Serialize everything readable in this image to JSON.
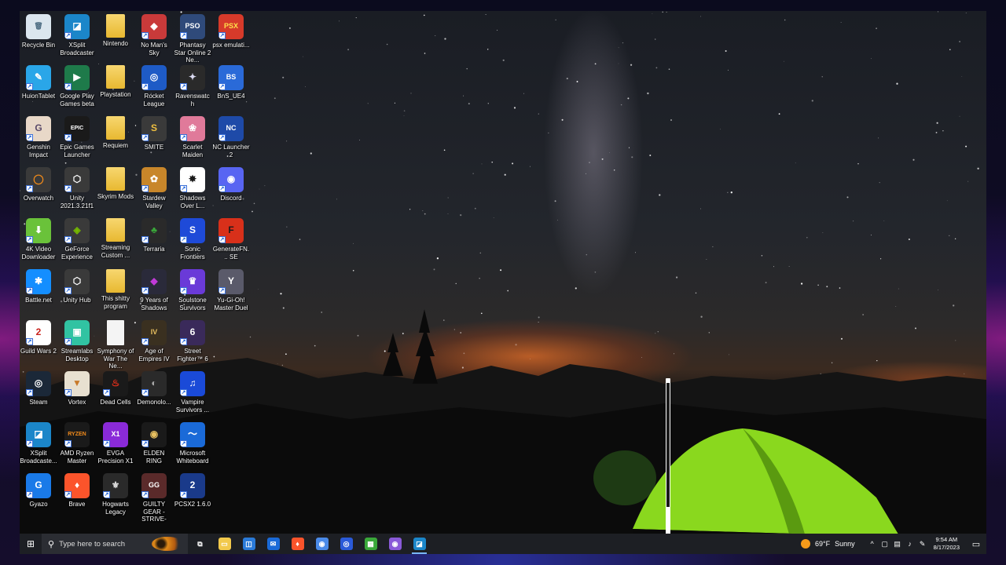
{
  "desktop": {
    "icons": [
      {
        "label": "Recycle Bin",
        "icon": "recycle-bin-icon",
        "glyph": "🗑",
        "color": "#dbe6ee",
        "fg": "#4a6a80",
        "shortcut": false
      },
      {
        "label": "XSplit Broadcaster",
        "icon": "xsplit-icon",
        "glyph": "◪",
        "color": "#1b86c9",
        "fg": "#ffffff",
        "shortcut": true
      },
      {
        "label": "Nintendo",
        "icon": "folder-icon",
        "glyph": "",
        "color": "#f2c94c",
        "fg": "#ffffff",
        "shortcut": false
      },
      {
        "label": "No Man's Sky",
        "icon": "no-mans-sky-icon",
        "glyph": "◆",
        "color": "#c93a3a",
        "fg": "#ffffff",
        "shortcut": true
      },
      {
        "label": "Phantasy Star Online 2 Ne...",
        "icon": "pso2-icon",
        "glyph": "PSO",
        "color": "#2f4a7a",
        "fg": "#ffffff",
        "shortcut": true
      },
      {
        "label": "psx emulati...",
        "icon": "psx-icon",
        "glyph": "PSX",
        "color": "#d63a2a",
        "fg": "#ffe04a",
        "shortcut": true
      },
      {
        "label": "HuionTablet",
        "icon": "huion-icon",
        "glyph": "✎",
        "color": "#2aa6e8",
        "fg": "#ffffff",
        "shortcut": true
      },
      {
        "label": "Google Play Games beta",
        "icon": "google-play-games-icon",
        "glyph": "▶",
        "color": "#1e7a4a",
        "fg": "#ffffff",
        "shortcut": true
      },
      {
        "label": "Playstation",
        "icon": "folder-icon",
        "glyph": "",
        "color": "#f2c94c",
        "fg": "#ffffff",
        "shortcut": false
      },
      {
        "label": "Rocket League",
        "icon": "rocket-league-icon",
        "glyph": "◎",
        "color": "#1e5bc6",
        "fg": "#ffffff",
        "shortcut": true
      },
      {
        "label": "Ravenswatch",
        "icon": "ravenswatch-icon",
        "glyph": "✦",
        "color": "#2a2a2a",
        "fg": "#d8d8f0",
        "shortcut": true
      },
      {
        "label": "BnS_UE4",
        "icon": "bns-icon",
        "glyph": "BS",
        "color": "#2a6ad8",
        "fg": "#ffffff",
        "shortcut": true
      },
      {
        "label": "Genshin Impact",
        "icon": "genshin-icon",
        "glyph": "G",
        "color": "#e8d8c8",
        "fg": "#5a4a6a",
        "shortcut": true
      },
      {
        "label": "Epic Games Launcher",
        "icon": "epic-games-icon",
        "glyph": "EPIC",
        "color": "#1a1a1a",
        "fg": "#ffffff",
        "shortcut": true
      },
      {
        "label": "Requiem",
        "icon": "folder-icon",
        "glyph": "",
        "color": "#f2c94c",
        "fg": "#ffffff",
        "shortcut": false
      },
      {
        "label": "SMITE",
        "icon": "smite-icon",
        "glyph": "S",
        "color": "#3a3a3a",
        "fg": "#f0c040",
        "shortcut": true
      },
      {
        "label": "Scarlet Maiden",
        "icon": "scarlet-maiden-icon",
        "glyph": "❀",
        "color": "#e07a9a",
        "fg": "#ffffff",
        "shortcut": true
      },
      {
        "label": "NC Launcher 2",
        "icon": "nc-launcher-icon",
        "glyph": "NC",
        "color": "#1e4aa8",
        "fg": "#ffffff",
        "shortcut": true
      },
      {
        "label": "Overwatch",
        "icon": "overwatch-icon",
        "glyph": "◯",
        "color": "#3a3a3a",
        "fg": "#f08a1a",
        "shortcut": true
      },
      {
        "label": "Unity 2021.3.21f1",
        "icon": "unity-icon",
        "glyph": "⬡",
        "color": "#3a3a3a",
        "fg": "#ffffff",
        "shortcut": true
      },
      {
        "label": "Skyrim Mods",
        "icon": "folder-icon",
        "glyph": "",
        "color": "#f2c94c",
        "fg": "#ffffff",
        "shortcut": false
      },
      {
        "label": "Stardew Valley",
        "icon": "stardew-icon",
        "glyph": "✿",
        "color": "#c8862a",
        "fg": "#ffffff",
        "shortcut": true
      },
      {
        "label": "Shadows Over L...",
        "icon": "shadows-icon",
        "glyph": "✸",
        "color": "#ffffff",
        "fg": "#1a1a1a",
        "shortcut": true
      },
      {
        "label": "Discord",
        "icon": "discord-icon",
        "glyph": "◉",
        "color": "#5865f2",
        "fg": "#ffffff",
        "shortcut": true
      },
      {
        "label": "4K Video Downloader",
        "icon": "4k-downloader-icon",
        "glyph": "⬇",
        "color": "#6ac23a",
        "fg": "#ffffff",
        "shortcut": true
      },
      {
        "label": "GeForce Experience",
        "icon": "geforce-icon",
        "glyph": "◈",
        "color": "#3a3a3a",
        "fg": "#76b900",
        "shortcut": true
      },
      {
        "label": "Streaming Custom ...",
        "icon": "folder-icon",
        "glyph": "",
        "color": "#f2c94c",
        "fg": "#ffffff",
        "shortcut": false
      },
      {
        "label": "Terraria",
        "icon": "terraria-icon",
        "glyph": "♣",
        "color": "#2a2a2a",
        "fg": "#3aa83a",
        "shortcut": true
      },
      {
        "label": "Sonic Frontiers",
        "icon": "sonic-icon",
        "glyph": "S",
        "color": "#1e4ad8",
        "fg": "#ffffff",
        "shortcut": true
      },
      {
        "label": "GenerateFN... SE",
        "icon": "generatefn-icon",
        "glyph": "F",
        "color": "#d8301a",
        "fg": "#1a1a1a",
        "shortcut": true
      },
      {
        "label": "Battle.net",
        "icon": "battlenet-icon",
        "glyph": "✱",
        "color": "#148eff",
        "fg": "#ffffff",
        "shortcut": true
      },
      {
        "label": "Unity Hub",
        "icon": "unity-hub-icon",
        "glyph": "⬡",
        "color": "#3a3a3a",
        "fg": "#ffffff",
        "shortcut": true
      },
      {
        "label": "This shitty program",
        "icon": "folder-icon",
        "glyph": "",
        "color": "#f2c94c",
        "fg": "#ffffff",
        "shortcut": false
      },
      {
        "label": "9 Years of Shadows",
        "icon": "9-years-icon",
        "glyph": "◆",
        "color": "#2a2a3a",
        "fg": "#c03ad8",
        "shortcut": true
      },
      {
        "label": "Soulstone Survivors",
        "icon": "soulstone-icon",
        "glyph": "♛",
        "color": "#6a3ad8",
        "fg": "#ffffff",
        "shortcut": true
      },
      {
        "label": "Yu-Gi-Oh! Master Duel",
        "icon": "yugioh-icon",
        "glyph": "Y",
        "color": "#5a5a6a",
        "fg": "#ffffff",
        "shortcut": true
      },
      {
        "label": "Guild Wars 2",
        "icon": "guild-wars-icon",
        "glyph": "2",
        "color": "#ffffff",
        "fg": "#c8201a",
        "shortcut": true
      },
      {
        "label": "Streamlabs Desktop",
        "icon": "streamlabs-icon",
        "glyph": "▣",
        "color": "#31c3a2",
        "fg": "#ffffff",
        "shortcut": true
      },
      {
        "label": "Symphony of War The Ne...",
        "icon": "document-icon",
        "glyph": "",
        "color": "#f4f4f4",
        "fg": "#aaaaaa",
        "shortcut": false
      },
      {
        "label": "Age of Empires IV",
        "icon": "age-of-empires-icon",
        "glyph": "IV",
        "color": "#3a3020",
        "fg": "#e8c060",
        "shortcut": true
      },
      {
        "label": "Street Fighter™ 6",
        "icon": "street-fighter-icon",
        "glyph": "6",
        "color": "#3a2a5a",
        "fg": "#ffffff",
        "shortcut": true
      },
      {
        "label": "",
        "icon": "empty-slot",
        "glyph": "",
        "color": "",
        "fg": "",
        "shortcut": false
      },
      {
        "label": "Steam",
        "icon": "steam-icon",
        "glyph": "◎",
        "color": "#1b2838",
        "fg": "#ffffff",
        "shortcut": true
      },
      {
        "label": "Vortex",
        "icon": "vortex-icon",
        "glyph": "▼",
        "color": "#e8e0d0",
        "fg": "#c87a2a",
        "shortcut": true
      },
      {
        "label": "Dead Cells",
        "icon": "dead-cells-icon",
        "glyph": "♨",
        "color": "#1a1a1a",
        "fg": "#e8301a",
        "shortcut": true
      },
      {
        "label": "Demonolo...",
        "icon": "demonologist-icon",
        "glyph": "◐",
        "color": "#2a2a2a",
        "fg": "#aaaaaa",
        "shortcut": true
      },
      {
        "label": "Vampire Survivors ...",
        "icon": "music-note-icon",
        "glyph": "♫",
        "color": "#1a4ad8",
        "fg": "#ffffff",
        "shortcut": true
      },
      {
        "label": "",
        "icon": "empty-slot",
        "glyph": "",
        "color": "",
        "fg": "",
        "shortcut": false
      },
      {
        "label": "XSplit Broadcaste...",
        "icon": "xsplit-icon",
        "glyph": "◪",
        "color": "#1b86c9",
        "fg": "#ffffff",
        "shortcut": true
      },
      {
        "label": "AMD Ryzen Master",
        "icon": "ryzen-icon",
        "glyph": "RYZEN",
        "color": "#1a1a1a",
        "fg": "#f08a1a",
        "shortcut": true
      },
      {
        "label": "EVGA Precision X1",
        "icon": "evga-icon",
        "glyph": "X1",
        "color": "#8a2ad8",
        "fg": "#ffffff",
        "shortcut": true
      },
      {
        "label": "ELDEN RING",
        "icon": "elden-ring-icon",
        "glyph": "◉",
        "color": "#1a1a1a",
        "fg": "#e8c060",
        "shortcut": true
      },
      {
        "label": "Microsoft Whiteboard",
        "icon": "whiteboard-icon",
        "glyph": "〜",
        "color": "#1a6ad8",
        "fg": "#ffffff",
        "shortcut": true
      },
      {
        "label": "",
        "icon": "empty-slot",
        "glyph": "",
        "color": "",
        "fg": "",
        "shortcut": false
      },
      {
        "label": "Gyazo",
        "icon": "gyazo-icon",
        "glyph": "G",
        "color": "#1a7ae8",
        "fg": "#ffffff",
        "shortcut": true
      },
      {
        "label": "Brave",
        "icon": "brave-icon",
        "glyph": "♦",
        "color": "#fb542b",
        "fg": "#ffffff",
        "shortcut": true
      },
      {
        "label": "Hogwarts Legacy",
        "icon": "hogwarts-icon",
        "glyph": "⚜",
        "color": "#2a2a2a",
        "fg": "#d8d8d8",
        "shortcut": true
      },
      {
        "label": "GUILTY GEAR -STRIVE-",
        "icon": "guilty-gear-icon",
        "glyph": "GG",
        "color": "#5a2a2a",
        "fg": "#ffffff",
        "shortcut": true
      },
      {
        "label": "PCSX2 1.6.0",
        "icon": "pcsx2-icon",
        "glyph": "2",
        "color": "#1a3a8a",
        "fg": "#ffffff",
        "shortcut": true
      }
    ]
  },
  "taskbar": {
    "search_placeholder": "Type here to search",
    "pinned": [
      {
        "name": "task-view-icon",
        "glyph": "⧉",
        "color": "transparent",
        "active": false
      },
      {
        "name": "file-explorer-icon",
        "glyph": "▭",
        "color": "#f2c94c",
        "active": false
      },
      {
        "name": "microsoft-store-icon",
        "glyph": "◫",
        "color": "#2a7ad8",
        "active": false
      },
      {
        "name": "mail-icon",
        "glyph": "✉",
        "color": "#1a6ad8",
        "active": false
      },
      {
        "name": "brave-icon",
        "glyph": "♦",
        "color": "#fb542b",
        "active": false
      },
      {
        "name": "chrome-icon",
        "glyph": "◉",
        "color": "#4a8ae8",
        "active": false
      },
      {
        "name": "steam-icon",
        "glyph": "◎",
        "color": "#2a5ad8",
        "active": false
      },
      {
        "name": "minecraft-icon",
        "glyph": "▦",
        "color": "#3aa83a",
        "active": false
      },
      {
        "name": "discord-canary-icon",
        "glyph": "◉",
        "color": "#8a5ad8",
        "active": false
      },
      {
        "name": "xsplit-icon",
        "glyph": "◪",
        "color": "#1b86c9",
        "active": true
      }
    ],
    "weather": {
      "temp": "69°F",
      "condition": "Sunny"
    },
    "clock": {
      "time": "9:54 AM",
      "date": "8/17/2023"
    }
  }
}
